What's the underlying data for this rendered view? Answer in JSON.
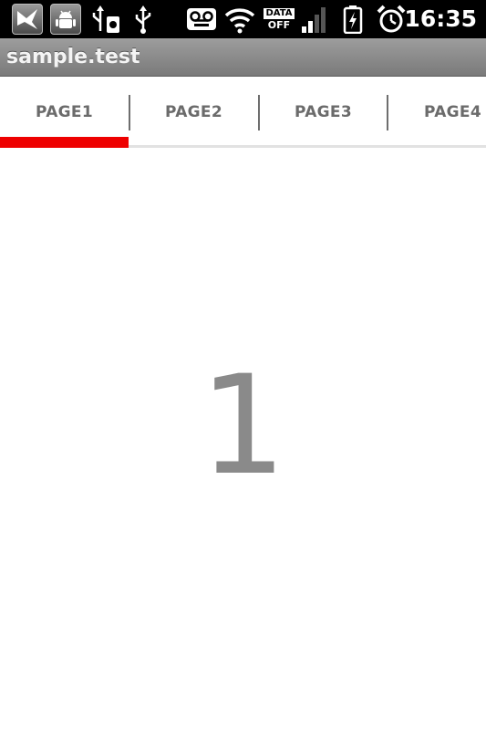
{
  "status_bar": {
    "time": "16:35",
    "data_label_top": "DATA",
    "data_label_bottom": "OFF",
    "icons": [
      "notification-icon",
      "android-debug-icon",
      "usb-storage-icon",
      "usb-icon",
      "voicemail-icon",
      "wifi-icon",
      "data-off-icon",
      "signal-icon",
      "battery-charging-icon",
      "alarm-icon"
    ]
  },
  "app_bar": {
    "title": "sample.test"
  },
  "tabs": [
    {
      "label": "PAGE1",
      "selected": true
    },
    {
      "label": "PAGE2",
      "selected": false
    },
    {
      "label": "PAGE3",
      "selected": false
    },
    {
      "label": "PAGE4",
      "selected": false
    }
  ],
  "colors": {
    "indicator": "#ee0000",
    "tab_text": "#6b6b6b",
    "page_number": "#8a8a8a"
  },
  "content": {
    "page_number": "1"
  }
}
